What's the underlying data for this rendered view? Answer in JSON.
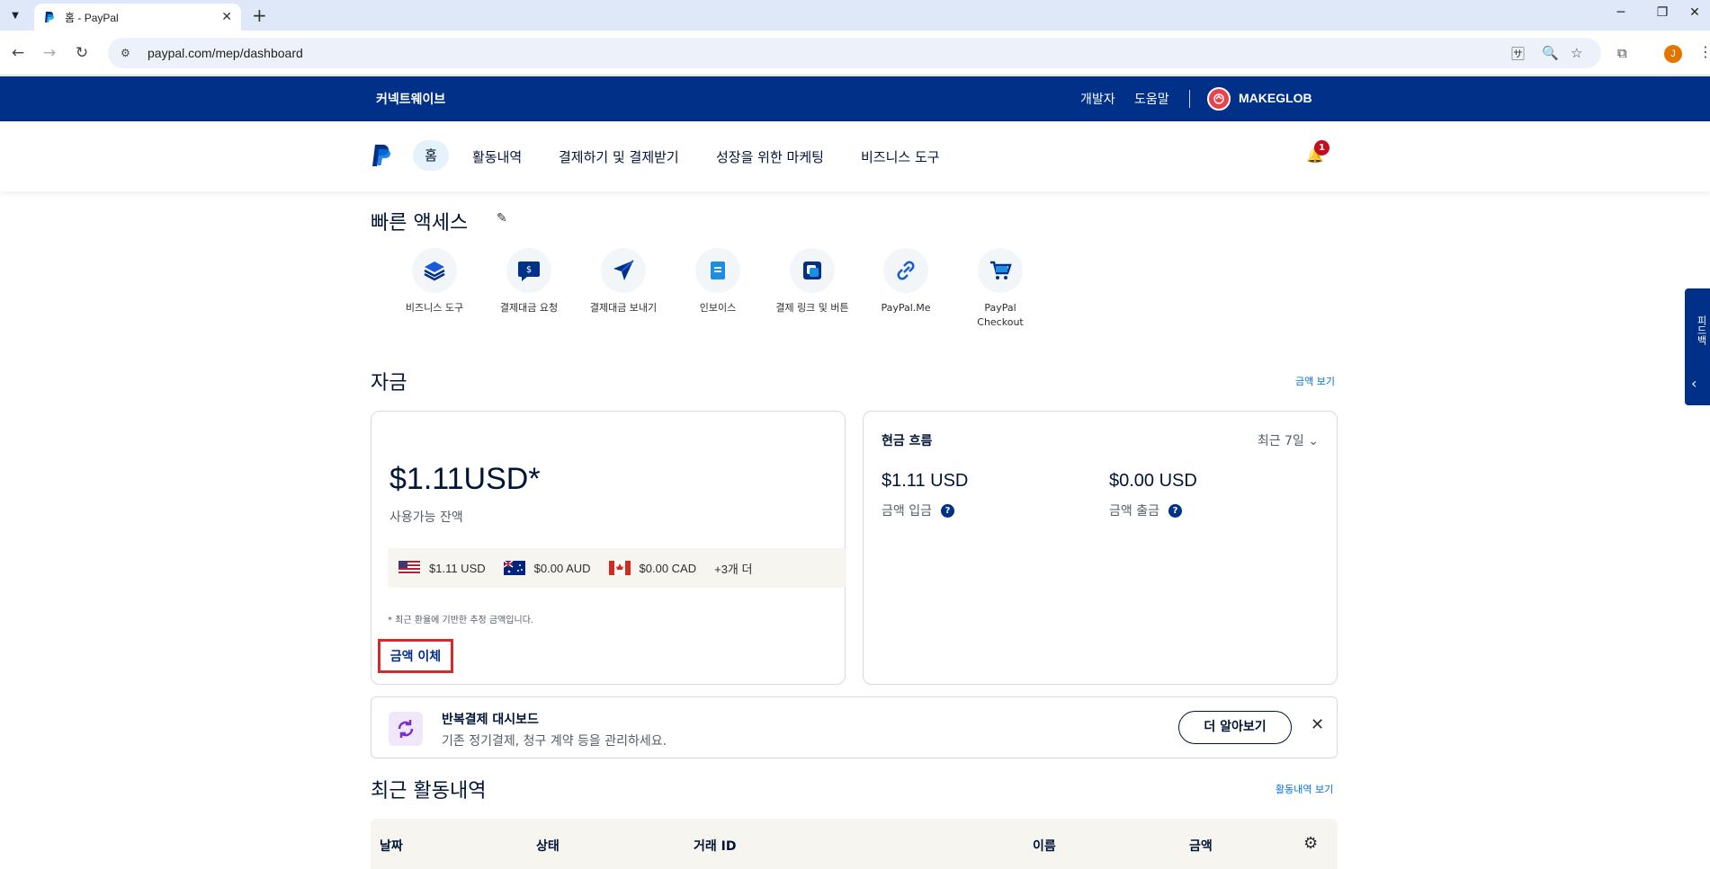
{
  "browser": {
    "tab_title": "홈 - PayPal",
    "url": "paypal.com/mep/dashboard",
    "profile_initial": "J"
  },
  "topbar": {
    "left_label": "커넥트웨이브",
    "developer": "개발자",
    "help": "도움말",
    "user_name": "MAKEGLOB"
  },
  "nav": {
    "home": "홈",
    "items": [
      "활동내역",
      "결제하기 및 결제받기",
      "성장을 위한 마케팅",
      "비즈니스 도구"
    ],
    "notification_count": "1"
  },
  "quick_access": {
    "title": "빠른 액세스",
    "items": [
      {
        "label": "비즈니스 도구",
        "icon": "stack-icon"
      },
      {
        "label": "결제대금 요청",
        "icon": "request-money-icon"
      },
      {
        "label": "결제대금 보내기",
        "icon": "send-icon"
      },
      {
        "label": "인보이스",
        "icon": "invoice-icon"
      },
      {
        "label": "결제 링크 및 버튼",
        "icon": "payment-link-icon"
      },
      {
        "label": "PayPal.Me",
        "icon": "link-icon"
      },
      {
        "label": "PayPal Checkout",
        "icon": "cart-icon"
      }
    ]
  },
  "funds": {
    "title": "자금",
    "view_link": "금액 보기",
    "balance": "$1.11USD*",
    "balance_label": "사용가능 잔액",
    "currencies": [
      {
        "flag": "us-flag",
        "amount": "$1.11 USD"
      },
      {
        "flag": "au-flag",
        "amount": "$0.00 AUD"
      },
      {
        "flag": "ca-flag",
        "amount": "$0.00 CAD"
      }
    ],
    "more": "+3개 더",
    "note": "* 최근 환율에 기반한 추정 금액입니다.",
    "transfer": "금액 이체"
  },
  "cash_flow": {
    "title": "현금 흐름",
    "period": "최근 7일",
    "in_value": "$1.11 USD",
    "in_label": "금액 입금",
    "out_value": "$0.00 USD",
    "out_label": "금액 출금"
  },
  "recurring": {
    "title": "반복결제 대시보드",
    "subtitle": "기존 정기결제, 청구 계약 등을 관리하세요.",
    "button": "더 알아보기"
  },
  "activity": {
    "title": "최근 활동내역",
    "view_link": "활동내역 보기",
    "columns": [
      "날짜",
      "상태",
      "거래 ID",
      "이름",
      "금액"
    ]
  },
  "feedback": {
    "label": "피드백"
  },
  "colors": {
    "brand_navy": "#003087",
    "link_blue": "#0070e0",
    "highlight_red": "#d32a2a"
  }
}
